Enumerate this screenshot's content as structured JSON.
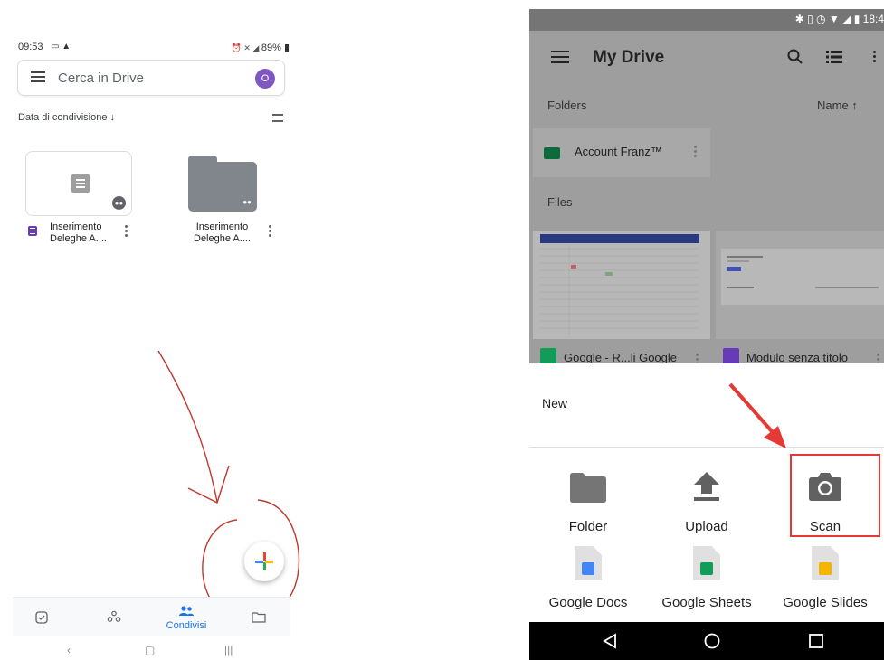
{
  "left_phone": {
    "status_time": "09:53",
    "status_battery": "89%",
    "search_placeholder": "Cerca in Drive",
    "avatar_initial": "O",
    "sort_label": "Data di condivisione",
    "files": [
      {
        "name_line1": "Inserimento",
        "name_line2": "Deleghe A....",
        "type": "form"
      },
      {
        "name_line1": "Inserimento",
        "name_line2": "Deleghe A....",
        "type": "shared-folder"
      }
    ],
    "nav_active_label": "Condivisi"
  },
  "right_phone": {
    "status_time": "18:4",
    "title": "My Drive",
    "folders_header": "Folders",
    "sort_label": "Name",
    "folder_name": "Account Franz™",
    "files_header": "Files",
    "file_tiles": [
      {
        "name": "Google - R...li Google",
        "type": "sheets"
      },
      {
        "name": "Modulo senza titolo",
        "type": "forms"
      }
    ],
    "sheet": {
      "title": "New",
      "options": [
        {
          "label": "Folder",
          "icon": "folder-icon"
        },
        {
          "label": "Upload",
          "icon": "upload-icon"
        },
        {
          "label": "Scan",
          "icon": "camera-icon"
        },
        {
          "label": "Google Docs",
          "icon": "docs-icon"
        },
        {
          "label": "Google Sheets",
          "icon": "sheets-icon"
        },
        {
          "label": "Google Slides",
          "icon": "slides-icon"
        }
      ]
    }
  },
  "colors": {
    "accent_blue": "#1a73e8",
    "annotation_red": "#e53935",
    "forms_purple": "#673ab7",
    "docs_blue": "#4285f4",
    "sheets_green": "#0f9d58",
    "slides_yellow": "#f4b400"
  }
}
